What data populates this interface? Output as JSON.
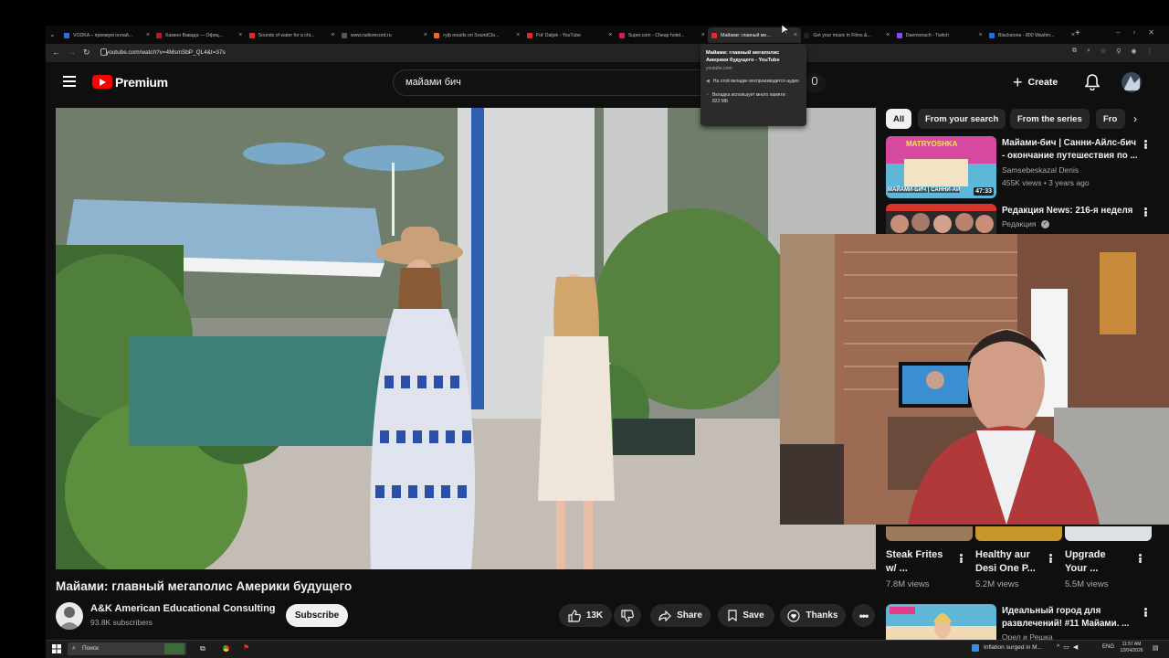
{
  "browser": {
    "tabs": [
      {
        "title": "VODKA – премиум онлай...",
        "color": "#2f6fd6"
      },
      {
        "title": "Казино Вавада — Офиц...",
        "color": "#c0182b"
      },
      {
        "title": "Sounds of water for a chi...",
        "color": "#e4282b"
      },
      {
        "title": "www.radiorecord.ru",
        "color": "#555555"
      },
      {
        "title": "гуф results on SoundClo...",
        "color": "#f26522"
      },
      {
        "title": "Put' Daljok - YouTube",
        "color": "#e4282b"
      },
      {
        "title": "Super.com - Cheap hotel...",
        "color": "#d81b60"
      },
      {
        "title": "Майами: главный ме...",
        "color": "#e4282b"
      },
      {
        "title": "Get your music in Films &...",
        "color": "#222222"
      },
      {
        "title": "Daemonach - Twitch",
        "color": "#9146ff"
      },
      {
        "title": "Blackstone - 800 Washin...",
        "color": "#1a73e8"
      }
    ],
    "url": "youtube.com/watch?v=4MsmSbP_QL4&t=37s",
    "tooltip": {
      "title": "Майами: главный мегаполис Америки будущего - YouTube",
      "domain": "youtube.com",
      "audio_note": "На этой вкладке воспроизводится аудио",
      "memory_note": "Вкладка использует много памяти:",
      "memory_value": "822 МБ"
    }
  },
  "youtube": {
    "logo": "Premium",
    "search_query": "майами бич",
    "create_label": "Create",
    "video": {
      "title": "Майами: главный мегаполис Америки будущего",
      "channel": "A&K American Educational Consulting",
      "subscribers": "93.8K subscribers",
      "subscribe_label": "Subscribe",
      "likes": "13K",
      "share_label": "Share",
      "save_label": "Save",
      "thanks_label": "Thanks"
    },
    "chips": [
      "All",
      "From your search",
      "From the series",
      "Fro"
    ],
    "recommendations": [
      {
        "title_line1": "Майами-бич | Санни-Айлс-бич",
        "title_line2": "- окончание путешествия по ...",
        "channel": "Samsebeskazal Denis",
        "meta": "455K views • 3 years ago",
        "duration": "47:33",
        "thumb_label_top": "MATRYOSHKA",
        "thumb_label_bottom": "МАЙАМИ-БИЧ | САННИ-АЙ"
      },
      {
        "title_line1": "Редакция News: 216-я неделя",
        "channel": "Редакция"
      },
      {
        "title_line1": "Идеальный город для",
        "title_line2": "развлечений! #11 Майами. ...",
        "channel": "Орел и Решка"
      }
    ],
    "shorts": [
      {
        "title_line1": "Steak Frites",
        "title_line2": "w/ ...",
        "views": "7.8M views"
      },
      {
        "title_line1": "Healthy aur",
        "title_line2": "Desi One P...",
        "views": "5.2M views"
      },
      {
        "title_line1": "Upgrade",
        "title_line2": "Your ...",
        "views": "5.5M views"
      }
    ]
  },
  "taskbar": {
    "search_label": "Поиск",
    "news": "Inflation surged in M...",
    "lang": "ENG",
    "time": "11:57 AM",
    "date": "12/04/2026"
  }
}
